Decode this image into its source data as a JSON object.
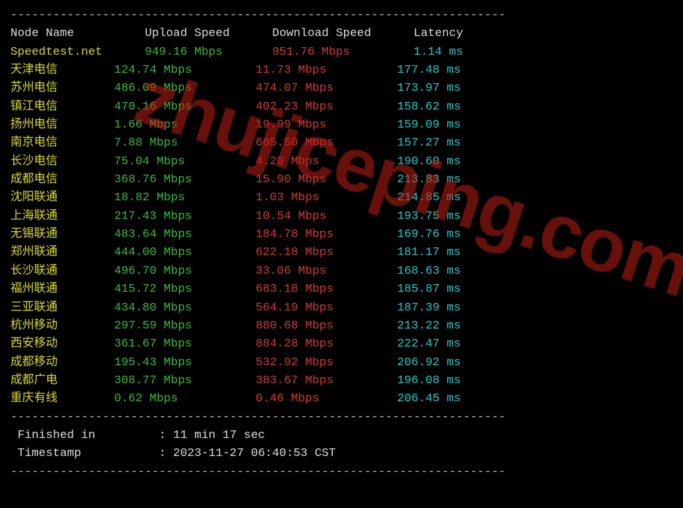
{
  "separator": "----------------------------------------------------------------------",
  "headers": {
    "node": "Node Name",
    "upload": "Upload Speed",
    "download": "Download Speed",
    "latency": "Latency"
  },
  "first_row": {
    "node": "Speedtest.net",
    "upload": "949.16 Mbps",
    "download": "951.76 Mbps",
    "latency": "1.14 ms"
  },
  "rows": [
    {
      "node": "天津电信",
      "upload": "124.74 Mbps",
      "download": "11.73 Mbps",
      "latency": "177.48 ms"
    },
    {
      "node": "苏州电信",
      "upload": "486.09 Mbps",
      "download": "474.07 Mbps",
      "latency": "173.97 ms"
    },
    {
      "node": "镇江电信",
      "upload": "470.16 Mbps",
      "download": "402.23 Mbps",
      "latency": "158.62 ms"
    },
    {
      "node": "扬州电信",
      "upload": "1.66 Mbps",
      "download": "19.99 Mbps",
      "latency": "159.09 ms"
    },
    {
      "node": "南京电信",
      "upload": "7.88 Mbps",
      "download": "665.50 Mbps",
      "latency": "157.27 ms"
    },
    {
      "node": "长沙电信",
      "upload": "75.04 Mbps",
      "download": "4.20 Mbps",
      "latency": "190.60 ms"
    },
    {
      "node": "成都电信",
      "upload": "368.76 Mbps",
      "download": "15.90 Mbps",
      "latency": "213.83 ms"
    },
    {
      "node": "沈阳联通",
      "upload": "18.82 Mbps",
      "download": "1.03 Mbps",
      "latency": "214.85 ms"
    },
    {
      "node": "上海联通",
      "upload": "217.43 Mbps",
      "download": "10.54 Mbps",
      "latency": "193.75 ms"
    },
    {
      "node": "无锡联通",
      "upload": "483.64 Mbps",
      "download": "184.78 Mbps",
      "latency": "169.76 ms"
    },
    {
      "node": "郑州联通",
      "upload": "444.00 Mbps",
      "download": "622.18 Mbps",
      "latency": "181.17 ms"
    },
    {
      "node": "长沙联通",
      "upload": "496.70 Mbps",
      "download": "33.06 Mbps",
      "latency": "168.63 ms"
    },
    {
      "node": "福州联通",
      "upload": "415.72 Mbps",
      "download": "683.18 Mbps",
      "latency": "185.87 ms"
    },
    {
      "node": "三亚联通",
      "upload": "434.80 Mbps",
      "download": "564.19 Mbps",
      "latency": "187.39 ms"
    },
    {
      "node": "杭州移动",
      "upload": "297.59 Mbps",
      "download": "880.68 Mbps",
      "latency": "213.22 ms"
    },
    {
      "node": "西安移动",
      "upload": "361.67 Mbps",
      "download": "884.28 Mbps",
      "latency": "222.47 ms"
    },
    {
      "node": "成都移动",
      "upload": "195.43 Mbps",
      "download": "532.92 Mbps",
      "latency": "206.92 ms"
    },
    {
      "node": "成都广电",
      "upload": "308.77 Mbps",
      "download": "383.67 Mbps",
      "latency": "196.08 ms"
    },
    {
      "node": "重庆有线",
      "upload": "0.62 Mbps",
      "download": "0.46 Mbps",
      "latency": "206.45 ms"
    }
  ],
  "footer": {
    "finished_label": " Finished in",
    "finished_value": "11 min 17 sec",
    "timestamp_label": " Timestamp",
    "timestamp_value": "2023-11-27 06:40:53 CST"
  },
  "watermark": "zhujiceping.com",
  "chart_data": {
    "type": "table",
    "title": "Speedtest results by node",
    "columns": [
      "Node Name",
      "Upload Speed (Mbps)",
      "Download Speed (Mbps)",
      "Latency (ms)"
    ],
    "rows": [
      [
        "Speedtest.net",
        949.16,
        951.76,
        1.14
      ],
      [
        "天津电信",
        124.74,
        11.73,
        177.48
      ],
      [
        "苏州电信",
        486.09,
        474.07,
        173.97
      ],
      [
        "镇江电信",
        470.16,
        402.23,
        158.62
      ],
      [
        "扬州电信",
        1.66,
        19.99,
        159.09
      ],
      [
        "南京电信",
        7.88,
        665.5,
        157.27
      ],
      [
        "长沙电信",
        75.04,
        4.2,
        190.6
      ],
      [
        "成都电信",
        368.76,
        15.9,
        213.83
      ],
      [
        "沈阳联通",
        18.82,
        1.03,
        214.85
      ],
      [
        "上海联通",
        217.43,
        10.54,
        193.75
      ],
      [
        "无锡联通",
        483.64,
        184.78,
        169.76
      ],
      [
        "郑州联通",
        444.0,
        622.18,
        181.17
      ],
      [
        "长沙联通",
        496.7,
        33.06,
        168.63
      ],
      [
        "福州联通",
        415.72,
        683.18,
        185.87
      ],
      [
        "三亚联通",
        434.8,
        564.19,
        187.39
      ],
      [
        "杭州移动",
        297.59,
        880.68,
        213.22
      ],
      [
        "西安移动",
        361.67,
        884.28,
        222.47
      ],
      [
        "成都移动",
        195.43,
        532.92,
        206.92
      ],
      [
        "成都广电",
        308.77,
        383.67,
        196.08
      ],
      [
        "重庆有线",
        0.62,
        0.46,
        206.45
      ]
    ]
  }
}
